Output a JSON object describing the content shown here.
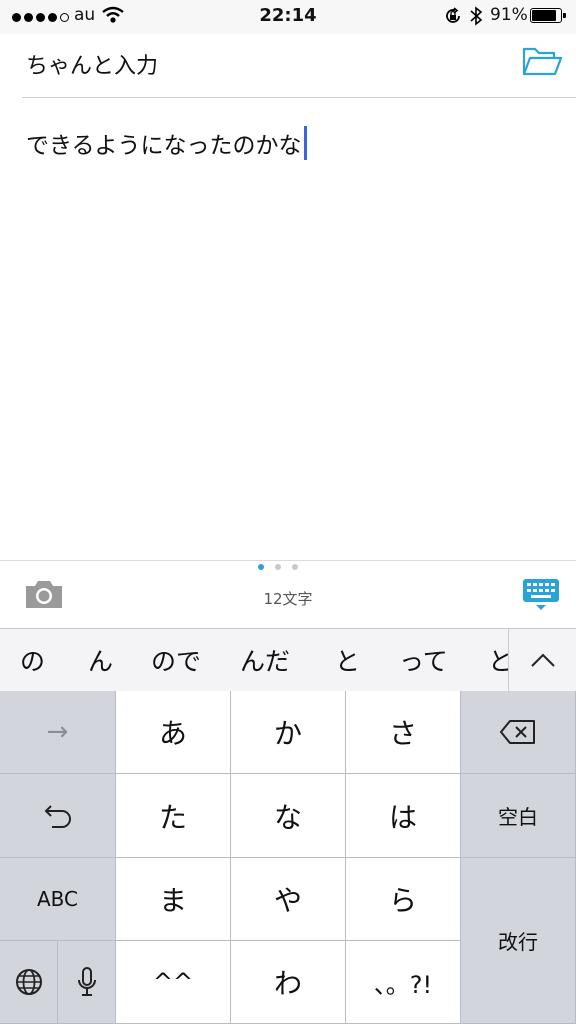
{
  "status_bar": {
    "carrier": "au",
    "time": "22:14",
    "battery_percent": "91%",
    "battery_level": 0.91,
    "signal_dots_filled": 4,
    "signal_dots_total": 5
  },
  "editor": {
    "title": "ちゃんと入力",
    "body": "できるようになったのかな"
  },
  "toolbar": {
    "char_count": "12文字",
    "page_index": 0,
    "page_total": 3
  },
  "keyboard": {
    "candidates": [
      "の",
      "ん",
      "ので",
      "んだ",
      "と",
      "って",
      "と"
    ],
    "rows": [
      {
        "left": "→",
        "keys": [
          "あ",
          "か",
          "さ"
        ],
        "right": "delete"
      },
      {
        "left": "undo",
        "keys": [
          "た",
          "な",
          "は"
        ],
        "right": "空白"
      },
      {
        "left": "ABC",
        "keys": [
          "ま",
          "や",
          "ら"
        ],
        "right": "改行"
      },
      {
        "left": "globe mic",
        "keys": [
          "^^",
          "わ",
          "、。?!"
        ]
      }
    ],
    "labels": {
      "arrow": "→",
      "abc": "ABC",
      "space": "空白",
      "return": "改行"
    }
  },
  "colors": {
    "accent": "#2aa3d8",
    "caret": "#3c63e0",
    "key_light": "#ffffff",
    "key_dark": "#d2d5db"
  },
  "icons": [
    "wifi-icon",
    "rotation-lock-icon",
    "bluetooth-icon",
    "battery-icon",
    "folder-icon",
    "camera-icon",
    "keyboard-hide-icon",
    "chevron-up-icon",
    "backspace-icon",
    "undo-icon",
    "globe-icon",
    "microphone-icon"
  ]
}
